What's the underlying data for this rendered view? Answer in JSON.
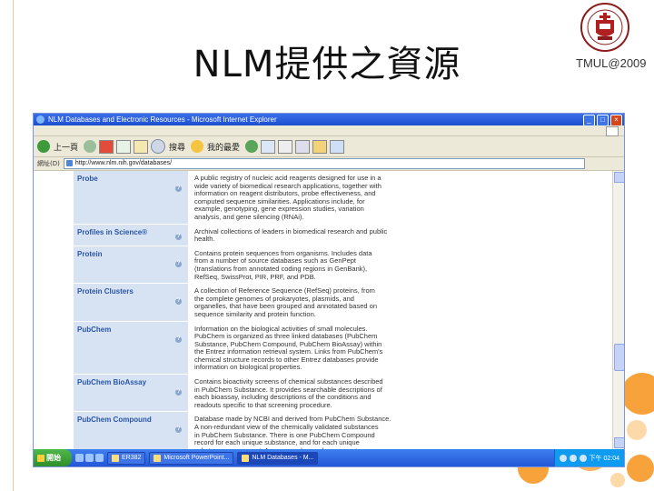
{
  "slide": {
    "title": "NLM提供之資源",
    "watermark": "TMUL@2009",
    "logo_icon": "university-seal-icon",
    "colors": {
      "accent_orange": "#f7a23a",
      "accent_light": "#fcd9a8",
      "rule": "#f0c79a"
    }
  },
  "browser": {
    "window_title": "NLM Databases and Electronic Resources - Microsoft Internet Explorer",
    "toolbar": {
      "back_label": "上一頁",
      "search_label": "搜尋",
      "favorites_label": "我的最愛"
    },
    "address_label": "網址(D)",
    "address_value": "http://www.nlm.nih.gov/databases/",
    "databases": [
      {
        "name": "Probe",
        "lines": [
          "A public registry of nucleic acid reagents designed for use in a",
          "wide variety of biomedical research applications, together with",
          "information on reagent distributors, probe effectiveness, and",
          "computed sequence similarities. Applications include, for",
          "example, genotyping, gene expression studies, variation",
          "analysis, and gene silencing (RNAi)."
        ]
      },
      {
        "name": "Profiles in Science®",
        "lines": [
          "Archival collections of leaders in biomedical research and public",
          "health."
        ]
      },
      {
        "name": "Protein",
        "lines": [
          "Contains protein sequences from organisms. Includes data",
          "from a number of source databases such as GenPept",
          "(translations from annotated coding regions in GenBank),",
          "RefSeq, SwissProt, PIR, PRF, and PDB."
        ]
      },
      {
        "name": "Protein Clusters",
        "lines": [
          "A collection of Reference Sequence (RefSeq) proteins, from",
          "the complete genomes of prokaryotes, plasmids, and",
          "organelles, that have been grouped and annotated based on",
          "sequence similarity and protein function."
        ]
      },
      {
        "name": "PubChem",
        "lines": [
          "Information on the biological activities of small molecules.",
          "PubChem is organized as three linked databases (PubChem",
          "Substance, PubChem Compound, PubChem BioAssay) within",
          "the Entrez information retrieval system. Links from PubChem's",
          "chemical structure records to other Entrez databases provide",
          "information on biological properties."
        ]
      },
      {
        "name": "PubChem BioAssay",
        "lines": [
          "Contains bioactivity screens of chemical substances described",
          "in PubChem Substance. It provides searchable descriptions of",
          "each bioassay, including descriptions of the conditions and",
          "readouts specific to that screening procedure."
        ]
      },
      {
        "name": "PubChem Compound",
        "lines": [
          "Database made by NCBI and derived from PubChem Substance.",
          "A non-redundant view of the chemically validated substances",
          "in PubChem Substance. There is one PubChem Compound",
          "record for each unique substance, and for each unique",
          "substance component. A compound record may map to more"
        ]
      }
    ],
    "taskbar": {
      "start_label": "開始",
      "tasks": [
        "ER382",
        "Microsoft PowerPoint...",
        "NLM Databases - M..."
      ],
      "clock": "下午 02:04"
    }
  }
}
